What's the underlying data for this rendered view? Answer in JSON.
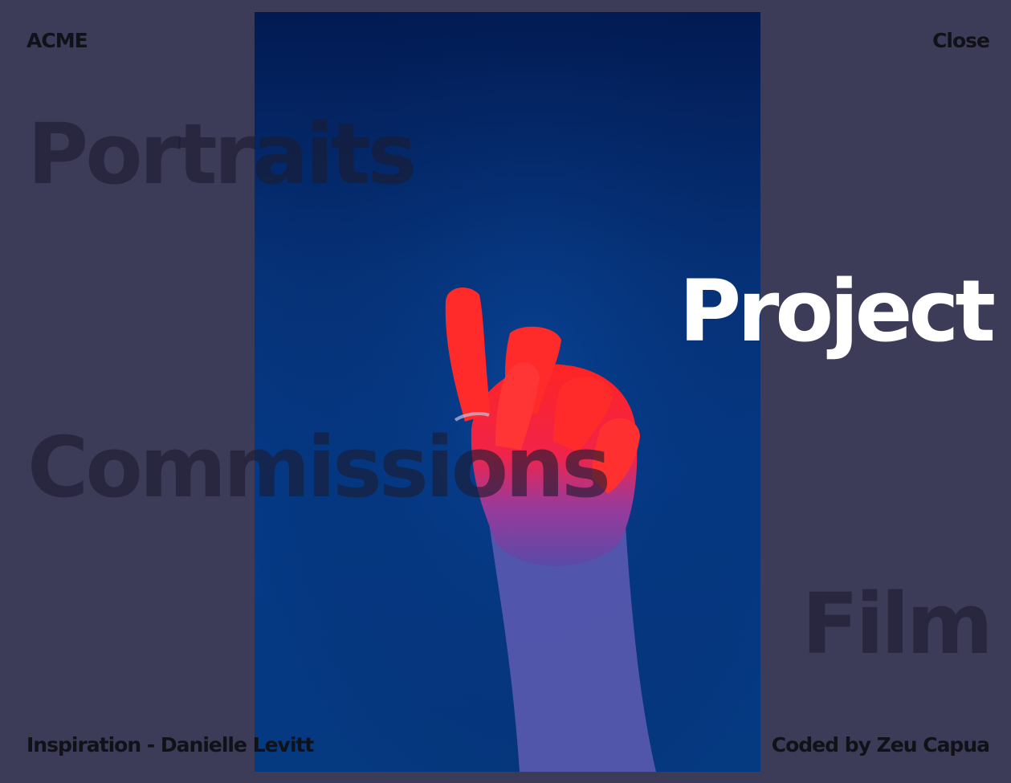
{
  "header": {
    "logo": "ACME",
    "close_label": "Close"
  },
  "menu": {
    "items": [
      {
        "label": "Portraits"
      },
      {
        "label": "Project"
      },
      {
        "label": "Commissions"
      },
      {
        "label": "Film"
      }
    ]
  },
  "footer": {
    "inspiration": "Inspiration - Danielle Levitt",
    "credit": "Coded by Zeu Capua"
  },
  "colors": {
    "background": "#3d3c58",
    "active_item": "#ffffff",
    "inactive_item": "#1c1c30",
    "photo_blue": "#053a86",
    "hand_red": "#ff2a2a"
  }
}
